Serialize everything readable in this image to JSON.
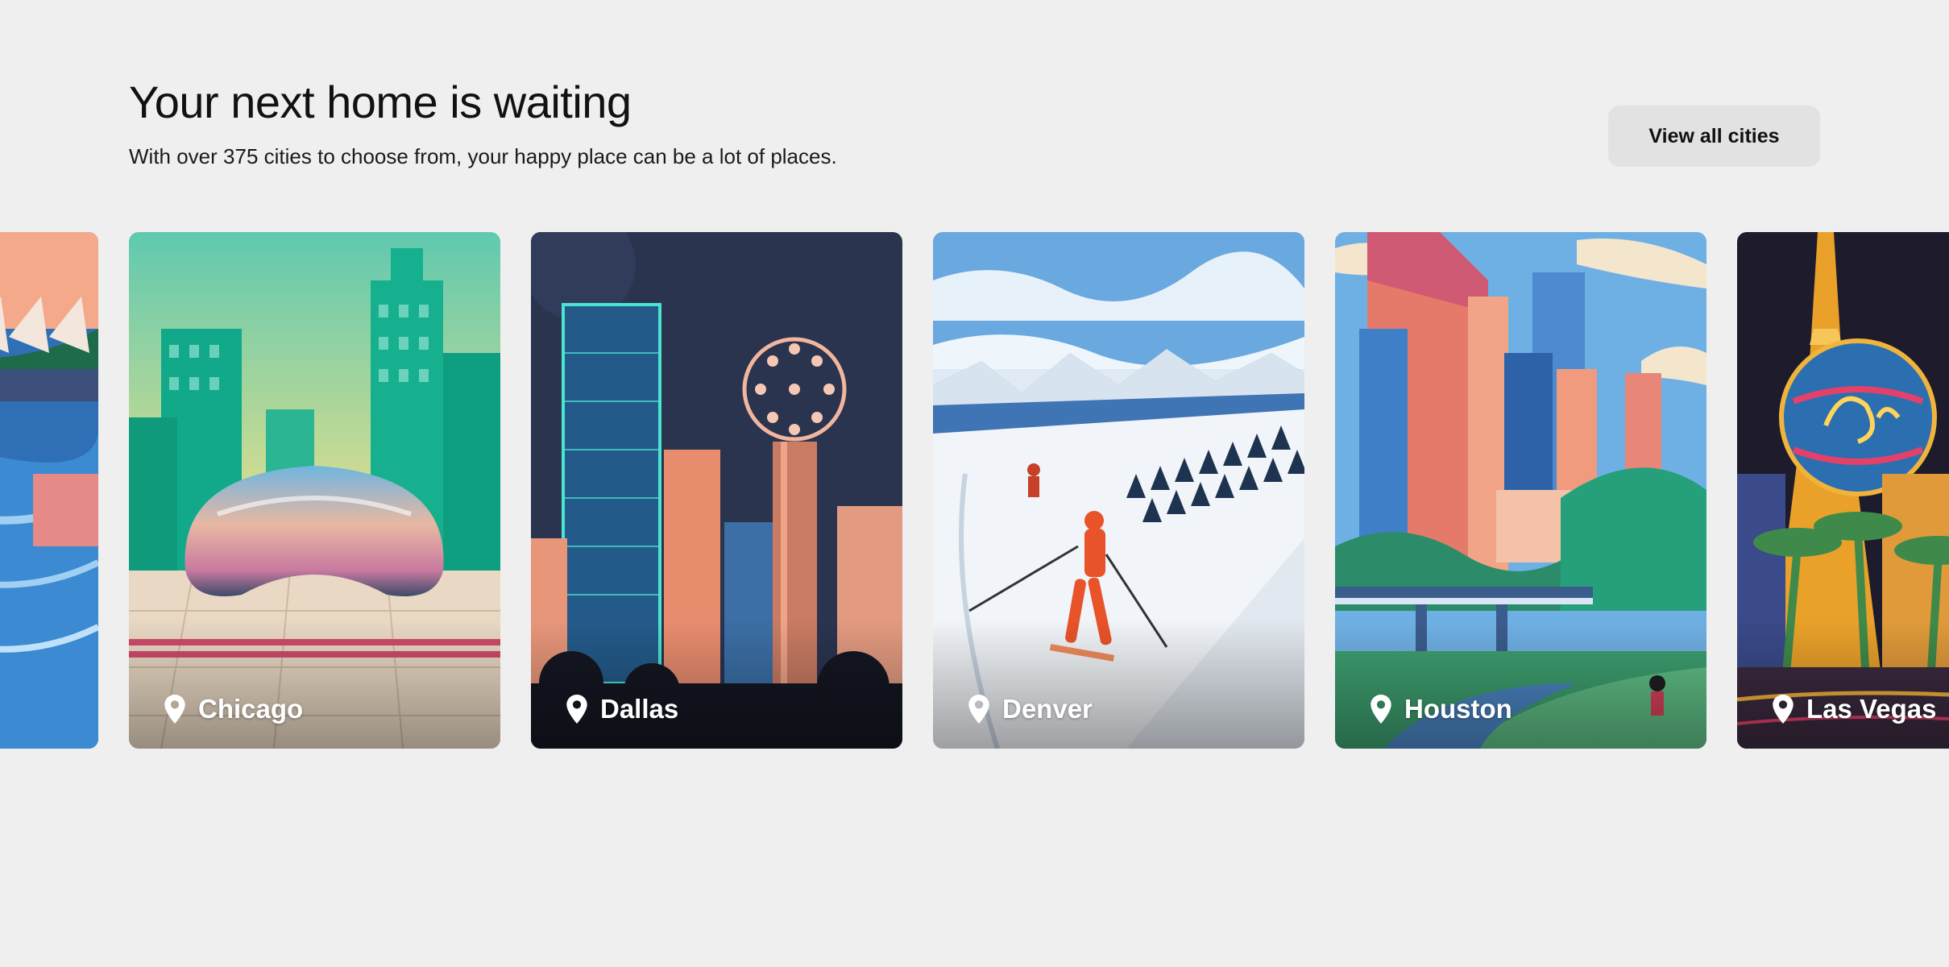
{
  "header": {
    "title": "Your next home is waiting",
    "subtitle": "With over 375 cities to choose from, your happy place can be a lot of places."
  },
  "actions": {
    "view_all_label": "View all cities"
  },
  "cities": [
    {
      "name": "Chicago",
      "icon": "location-pin-icon"
    },
    {
      "name": "Dallas",
      "icon": "location-pin-icon"
    },
    {
      "name": "Denver",
      "icon": "location-pin-icon"
    },
    {
      "name": "Houston",
      "icon": "location-pin-icon"
    },
    {
      "name": "Las Vegas",
      "icon": "location-pin-icon"
    }
  ],
  "colors": {
    "page_background": "#efefef",
    "button_background": "#e2e2e2",
    "text": "#111111"
  }
}
